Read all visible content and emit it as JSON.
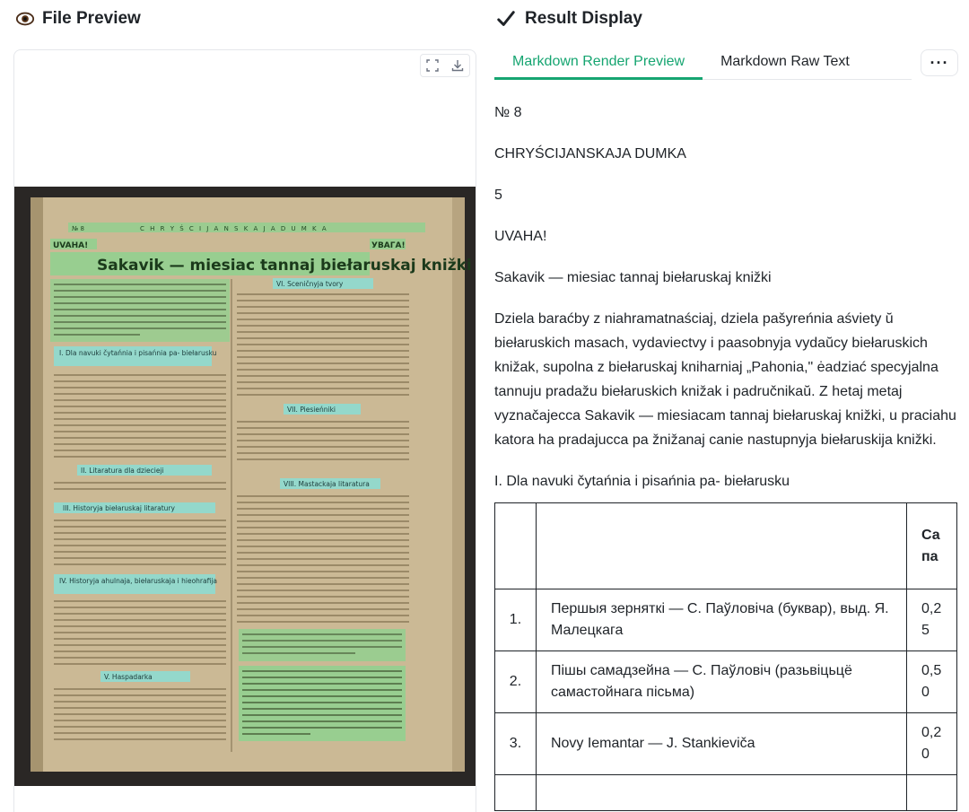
{
  "left_panel": {
    "title": "File Preview"
  },
  "right_panel": {
    "title": "Result Display"
  },
  "tabs": [
    {
      "label": "Markdown Render Preview",
      "active": true
    },
    {
      "label": "Markdown Raw Text",
      "active": false
    }
  ],
  "document_image": {
    "page_header_left": "№ 8",
    "page_header_center": "C H R Y Ś C I J A N S K A J A   D U M K A",
    "uvaha_left": "UVAHA!",
    "uvaha_right": "УВАГА!",
    "main_title": "Sakavik — miesiac tannaj biełaruskaj knižki",
    "sections": [
      "I. Dla navuki čytańnia i pisańnia pa- biełarusku",
      "II. Litaratura dla dziecieji",
      "III. Historyja biełaruskaj litaratury",
      "IV. Historyja ahulnaja, biełaruskaja i hieohrafija",
      "V. Haspadarka",
      "VI. Sceničnyja tvory",
      "VII. Piesieńniki",
      "VIII. Mastackaja litaratura"
    ]
  },
  "markdown": {
    "lines": [
      "№ 8",
      "CHRYŚCIJANSKAJA DUMKA",
      "5",
      "UVAHA!",
      "Sakavik — miesiac tannaj biełaruskaj knižki",
      "Dziela baraćby z niahramatnaściaj, dziela pašyreńnia aśviety ŭ biełaruskich masach, vydaviectvy i paasobnyja vydaŭcy biełaruskich knižak, supolna z biełaruskaj kniharniaj „Pahonia,\" ėadziać specyjalna tannuju pradažu biełaruskich knižak i padručnikaŭ. Z hetaj metaj vyznačajecca Sakavik — miesiacam tannaj biełaruskaj knižki, u praciahu katora ha pradajucca pa žnižanaj canie nastupnyja biełaruskija knižki.",
      "I. Dla navuki čytańnia i pisańnia pa- biełarusku"
    ],
    "table": {
      "header_last": "Сапа",
      "rows": [
        {
          "num": "1.",
          "title": "Першыя зерняткі — С. Паўловіча (буквар), выд. Я. Малецкага",
          "price": "0,25"
        },
        {
          "num": "2.",
          "title": "Пішы самадзейна — С. Паўловіч (разьвіцьцё самастойнага пісьма)",
          "price": "0,50"
        },
        {
          "num": "3.",
          "title": "Novy Iemantar — J. Stankieviča",
          "price": "0,20"
        }
      ]
    }
  },
  "colors": {
    "accent": "#16a571",
    "text": "#1f2328",
    "border": "#e5e7eb"
  },
  "icons": {
    "left_header": "eye-icon",
    "right_header": "check-icon",
    "fullscreen": "fullscreen-icon",
    "download": "download-icon",
    "more": "more-icon"
  }
}
